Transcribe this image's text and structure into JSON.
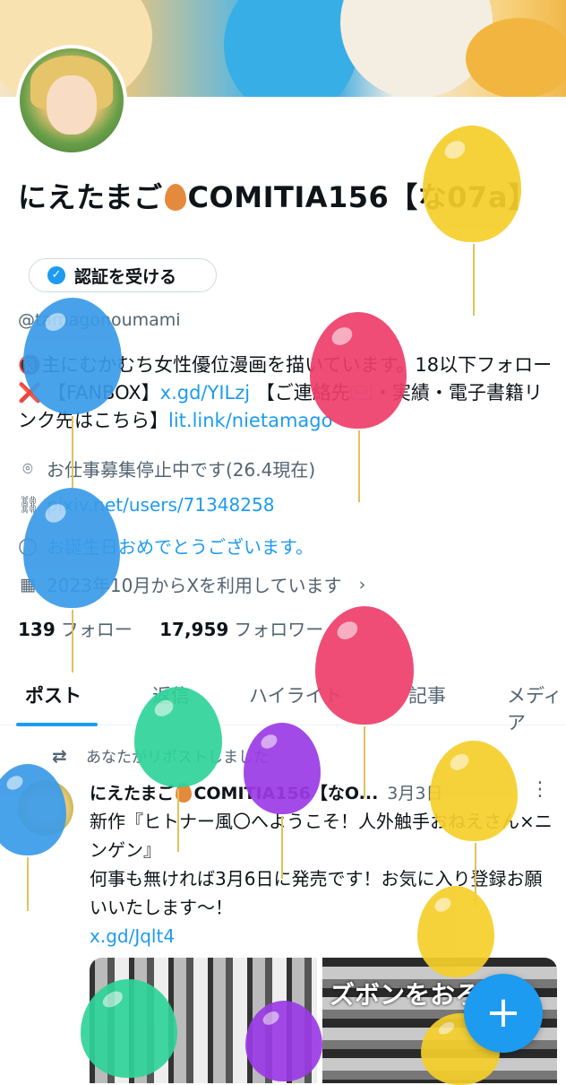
{
  "profile": {
    "display_name": "にえたまご🥚COMITIA156【な07a】",
    "name_part1": "にえたまご",
    "name_part2": "COMITIA156【な07a】",
    "verify_label": "認証を受ける",
    "handle": "@tamagonoumami",
    "bio_part1": "🔞主にむかむち女性優位漫画を描いています。18以下フォロー❌ 【FANBOX】",
    "bio_link1": "x.gd/YILzj",
    "bio_part2": " 【ご連絡先✉️・実績・電子書籍リンク先はこちら】",
    "bio_link2": "lit.link/nietamago",
    "location": "お仕事募集停止中です(26.4現在)",
    "website": "pixiv.net/users/71348258",
    "birthday": "お誕生日おめでとうございます。",
    "joined": "2023年10月からXを利用しています",
    "following_count": "139",
    "following_label": "フォロー",
    "followers_count": "17,959",
    "followers_label": "フォロワー"
  },
  "tabs": [
    "ポスト",
    "返信",
    "ハイライト",
    "記事",
    "メディア"
  ],
  "tweet": {
    "repost_label": "あなたがリポストしました",
    "author_part1": "にえたまご",
    "author_part2": "COMITIA156【なO...",
    "date": "3月3日",
    "line1": "新作『ヒトナー風〇へようこそ！人外触手おねえさん×ニンゲン』",
    "line2": "何事も無ければ3月6日に発売です！お気に入り登録お願いいたします～！",
    "link": "x.gd/Jqlt4",
    "image2_text": "ズボンをおろさ"
  },
  "icons": {
    "location": "location-pin-icon",
    "website": "link-icon",
    "birthday": "balloon-icon",
    "joined": "calendar-icon",
    "repost": "repost-icon",
    "more": "more-vertical-icon",
    "compose": "plus-icon",
    "verified": "verified-badge-icon"
  },
  "colors": {
    "accent": "#1d9bf0",
    "text": "#0f1419",
    "muted": "#536471",
    "balloon_blue": "#3a9be8",
    "balloon_yellow": "#f5cf2a",
    "balloon_pink": "#ee3e6a",
    "balloon_green": "#2fd39a",
    "balloon_purple": "#9b3be6"
  }
}
